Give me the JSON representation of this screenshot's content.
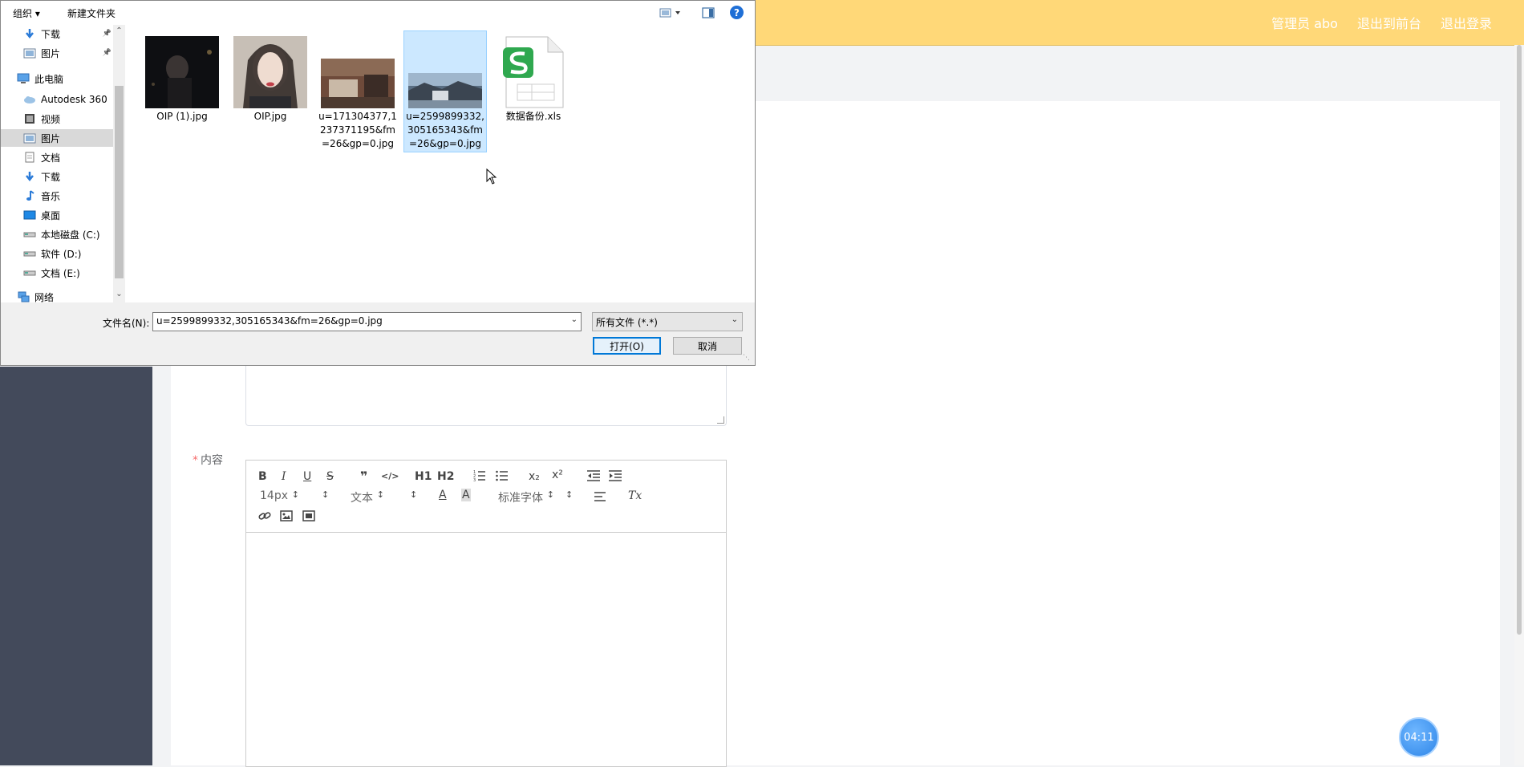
{
  "header": {
    "links": [
      "管理员 abo",
      "退出到前台",
      "退出登录"
    ],
    "bg_color": "#ffd878"
  },
  "form": {
    "content_label": "内容",
    "required_mark": "*"
  },
  "editor": {
    "toolbar_row1": {
      "bold": "B",
      "italic": "I",
      "underline": "U",
      "strike": "S",
      "blockquote": "❞",
      "code": "</>",
      "h1": "H1",
      "h2": "H2",
      "ordered_list": "ordered-list-icon",
      "bullet_list": "bullet-list-icon",
      "subscript": "x₂",
      "superscript": "x²",
      "outdent": "outdent-icon",
      "indent": "indent-icon"
    },
    "toolbar_row2": {
      "size": "14px",
      "header": "文本",
      "color": "A",
      "background": "A",
      "font": "标准字体",
      "align": "align-icon",
      "clean": "Tx"
    },
    "toolbar_row3": [
      "link-icon",
      "image-icon",
      "video-icon"
    ]
  },
  "timer": {
    "text": "04:11"
  },
  "dialog": {
    "toolbar": {
      "organize": "组织 ▾",
      "new_folder": "新建文件夹"
    },
    "nav": [
      {
        "label": "下载",
        "icon": "download-icon",
        "pinned": true
      },
      {
        "label": "图片",
        "icon": "pictures-icon",
        "pinned": true
      },
      {
        "label": "此电脑",
        "icon": "computer-icon",
        "pinned": false
      },
      {
        "label": "Autodesk 360",
        "icon": "cloud-icon",
        "pinned": false
      },
      {
        "label": "视频",
        "icon": "video-folder-icon",
        "pinned": false
      },
      {
        "label": "图片",
        "icon": "pictures-icon",
        "pinned": false,
        "selected": true
      },
      {
        "label": "文档",
        "icon": "documents-icon",
        "pinned": false
      },
      {
        "label": "下载",
        "icon": "download-icon",
        "pinned": false
      },
      {
        "label": "音乐",
        "icon": "music-icon",
        "pinned": false
      },
      {
        "label": "桌面",
        "icon": "desktop-icon",
        "pinned": false
      },
      {
        "label": "本地磁盘 (C:)",
        "icon": "drive-icon",
        "pinned": false
      },
      {
        "label": "软件 (D:)",
        "icon": "drive-icon",
        "pinned": false
      },
      {
        "label": "文档 (E:)",
        "icon": "drive-icon",
        "pinned": false
      },
      {
        "label": "网络",
        "icon": "network-icon",
        "pinned": false
      }
    ],
    "files": [
      {
        "name": "OIP (1).jpg",
        "type": "photo"
      },
      {
        "name": "OIP.jpg",
        "type": "photo"
      },
      {
        "name": "u=171304377,1237371195&fm=26&gp=0.jpg",
        "name_lines": [
          "u=171304377,1",
          "237371195&fm",
          "=26&gp=0.jpg"
        ],
        "type": "photo"
      },
      {
        "name": "u=2599899332,305165343&fm=26&gp=0.jpg",
        "name_lines": [
          "u=2599899332,",
          "305165343&fm",
          "=26&gp=0.jpg"
        ],
        "type": "photo",
        "selected": true
      },
      {
        "name": "数据备份.xls",
        "type": "spreadsheet"
      }
    ],
    "filename_label": "文件名(N):",
    "filename_value": "u=2599899332,305165343&fm=26&gp=0.jpg",
    "filetype_value": "所有文件 (*.*)",
    "open_label": "打开(O)",
    "cancel_label": "取消"
  }
}
